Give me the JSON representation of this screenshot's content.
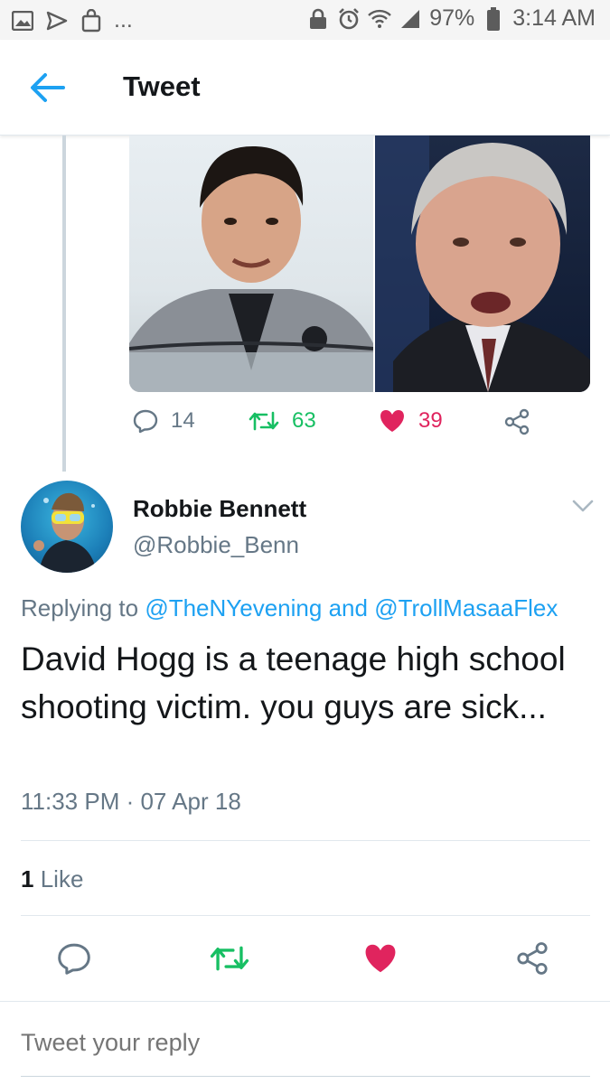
{
  "status_bar": {
    "dots": "...",
    "battery_percent": "97%",
    "time": "3:14 AM"
  },
  "header": {
    "title": "Tweet"
  },
  "previous_tweet": {
    "replies": "14",
    "retweets": "63",
    "likes": "39"
  },
  "reply_tweet": {
    "user_name": "Robbie Bennett",
    "handle": "@Robbie_Benn",
    "replying_prefix": "Replying to",
    "mention_1": "@TheNYevening",
    "and": "and",
    "mention_2": "@TrollMasaaFlex",
    "text": "David Hogg is a teenage high school shooting victim. you guys are sick...",
    "timestamp": "11:33 PM · 07 Apr 18",
    "like_count": "1",
    "like_label": "Like"
  },
  "reply_box": {
    "placeholder": "Tweet your reply"
  },
  "colors": {
    "twitter_blue": "#1da1f2",
    "retweet_green": "#17bf63",
    "like_red": "#e0245e",
    "gray": "#657786"
  }
}
